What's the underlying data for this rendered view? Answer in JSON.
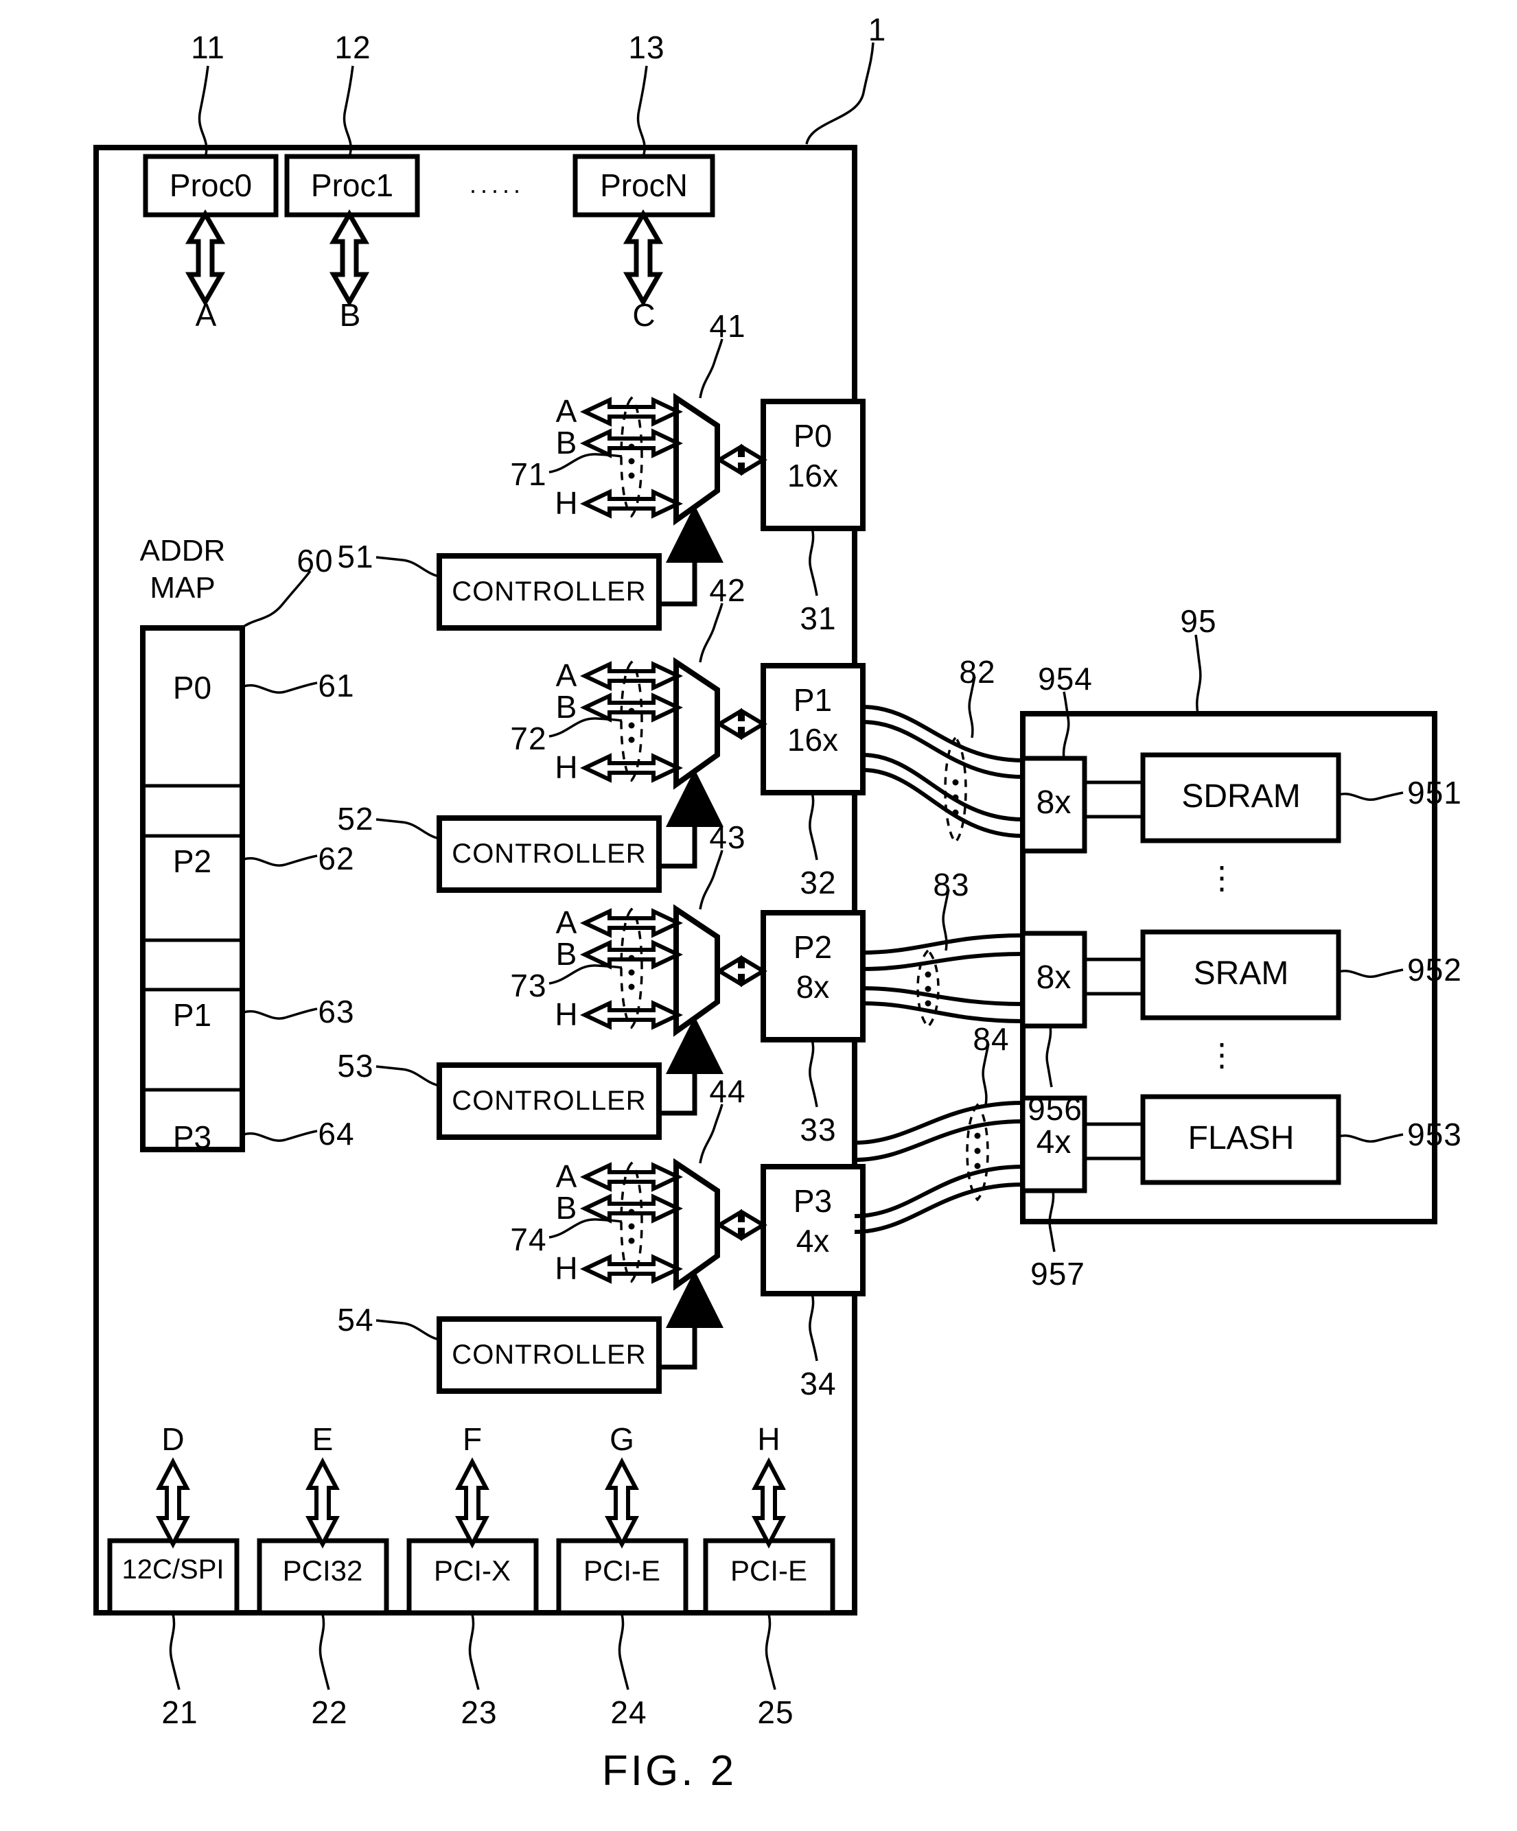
{
  "figure": {
    "caption": "FIG. 2",
    "system_ref": "1"
  },
  "processors": [
    {
      "label": "Proc0",
      "ref": "11",
      "signal": "A"
    },
    {
      "label": "Proc1",
      "ref": "12",
      "signal": "B"
    },
    {
      "label": "ProcN",
      "ref": "13",
      "signal": "C"
    }
  ],
  "processor_ellipsis": ". . . . .",
  "addr_map": {
    "title_line1": "ADDR",
    "title_line2": "MAP",
    "ref": "60",
    "rows": [
      {
        "label": "P0",
        "ref": "61"
      },
      {
        "label": "",
        "ref": ""
      },
      {
        "label": "P2",
        "ref": "62"
      },
      {
        "label": "",
        "ref": ""
      },
      {
        "label": "P1",
        "ref": "63"
      },
      {
        "label": "",
        "ref": ""
      },
      {
        "label": "P3",
        "ref": "64"
      }
    ]
  },
  "mux_stages": [
    {
      "mux_ref": "41",
      "bundle_ref": "71",
      "inputs": [
        "A",
        "B",
        "H"
      ],
      "controller_label": "CONTROLLER",
      "controller_ref": "51",
      "port_line1": "P0",
      "port_line2": "16x",
      "port_ref": "31"
    },
    {
      "mux_ref": "42",
      "bundle_ref": "72",
      "inputs": [
        "A",
        "B",
        "H"
      ],
      "controller_label": "CONTROLLER",
      "controller_ref": "52",
      "port_line1": "P1",
      "port_line2": "16x",
      "port_ref": "32"
    },
    {
      "mux_ref": "43",
      "bundle_ref": "73",
      "inputs": [
        "A",
        "B",
        "H"
      ],
      "controller_label": "CONTROLLER",
      "controller_ref": "53",
      "port_line1": "P2",
      "port_line2": "8x",
      "port_ref": "33"
    },
    {
      "mux_ref": "44",
      "bundle_ref": "74",
      "inputs": [
        "A",
        "B",
        "H"
      ],
      "controller_label": "CONTROLLER",
      "controller_ref": "54",
      "port_line1": "P3",
      "port_line2": "4x",
      "port_ref": "34"
    }
  ],
  "bus_bundles": [
    {
      "ref": "82"
    },
    {
      "ref": "83"
    },
    {
      "ref": "84"
    }
  ],
  "memory_subsystem": {
    "ref": "95",
    "banks": [
      {
        "width": "8x",
        "width_ref": "954",
        "name": "SDRAM",
        "name_ref": "951"
      },
      {
        "width": "8x",
        "width_ref": "956",
        "name": "SRAM",
        "name_ref": "952"
      },
      {
        "width": "4x",
        "width_ref": "957",
        "name": "FLASH",
        "name_ref": "953"
      }
    ],
    "vertical_ellipsis": "⋮"
  },
  "io_ports": [
    {
      "label": "12C/SPI",
      "ref": "21",
      "signal": "D"
    },
    {
      "label": "PCI32",
      "ref": "22",
      "signal": "E"
    },
    {
      "label": "PCI-X",
      "ref": "23",
      "signal": "F"
    },
    {
      "label": "PCI-E",
      "ref": "24",
      "signal": "G"
    },
    {
      "label": "PCI-E",
      "ref": "25",
      "signal": "H"
    }
  ],
  "colors": {
    "ink": "#000000",
    "paper": "#ffffff"
  }
}
